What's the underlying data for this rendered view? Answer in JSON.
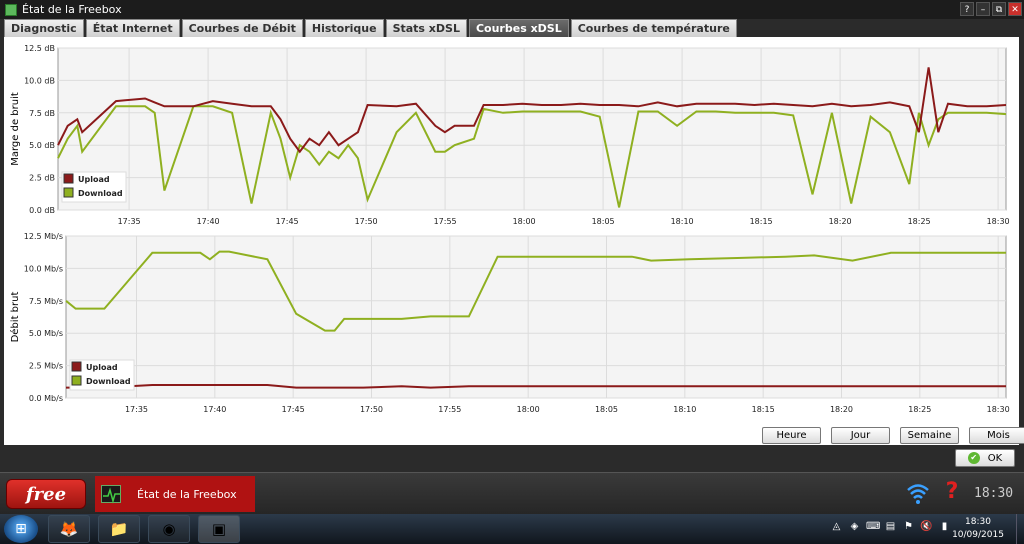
{
  "window": {
    "title": "État de la Freebox",
    "buttons": [
      "?",
      "–",
      "⧉",
      "✕"
    ]
  },
  "tabs": [
    {
      "label": "Diagnostic",
      "active": false
    },
    {
      "label": "État Internet",
      "active": false
    },
    {
      "label": "Courbes de Débit",
      "active": false
    },
    {
      "label": "Historique",
      "active": false
    },
    {
      "label": "Stats xDSL",
      "active": false
    },
    {
      "label": "Courbes xDSL",
      "active": true
    },
    {
      "label": "Courbes de température",
      "active": false
    }
  ],
  "range_buttons": [
    "Heure",
    "Jour",
    "Semaine",
    "Mois"
  ],
  "ok_label": "OK",
  "freebox_bar": {
    "logo": "free",
    "task_label": "État de la Freebox",
    "clock": "18:30"
  },
  "taskbar": {
    "time": "18:30",
    "date": "10/09/2015"
  },
  "colors": {
    "upload": "#8b1a1a",
    "download": "#8fb020"
  },
  "chart_data": [
    {
      "type": "line",
      "ylabel": "Marge de bruit",
      "ylim": [
        0,
        12.5
      ],
      "yticks": [
        "0.0 dB",
        "2.5 dB",
        "5.0 dB",
        "7.5 dB",
        "10.0 dB",
        "12.5 dB"
      ],
      "xticks": [
        "17:35",
        "17:40",
        "17:45",
        "17:50",
        "17:55",
        "18:00",
        "18:05",
        "18:10",
        "18:15",
        "18:20",
        "18:25",
        "18:30"
      ],
      "grid": true,
      "legend": "bottom-left",
      "series": [
        {
          "name": "Upload",
          "values": [
            [
              0,
              5.0
            ],
            [
              1,
              6.5
            ],
            [
              2,
              7.0
            ],
            [
              2.5,
              6.0
            ],
            [
              6,
              8.4
            ],
            [
              9,
              8.6
            ],
            [
              10,
              8.3
            ],
            [
              11,
              8.0
            ],
            [
              14,
              8.0
            ],
            [
              16,
              8.4
            ],
            [
              18,
              8.2
            ],
            [
              20,
              8.0
            ],
            [
              22,
              8.0
            ],
            [
              23,
              7.0
            ],
            [
              24,
              5.5
            ],
            [
              25,
              4.5
            ],
            [
              26,
              5.5
            ],
            [
              27,
              5.0
            ],
            [
              28,
              6.0
            ],
            [
              29,
              5.0
            ],
            [
              30,
              5.5
            ],
            [
              31,
              6.0
            ],
            [
              32,
              8.1
            ],
            [
              35,
              8.0
            ],
            [
              37,
              8.2
            ],
            [
              39,
              6.5
            ],
            [
              40,
              6.0
            ],
            [
              41,
              6.5
            ],
            [
              43,
              6.5
            ],
            [
              44,
              8.1
            ],
            [
              46,
              8.1
            ],
            [
              48,
              8.2
            ],
            [
              50,
              8.1
            ],
            [
              52,
              8.1
            ],
            [
              54,
              8.2
            ],
            [
              56,
              8.1
            ],
            [
              58,
              8.1
            ],
            [
              60,
              8.0
            ],
            [
              62,
              8.3
            ],
            [
              64,
              8.0
            ],
            [
              66,
              8.2
            ],
            [
              68,
              8.2
            ],
            [
              70,
              8.2
            ],
            [
              72,
              8.1
            ],
            [
              74,
              8.2
            ],
            [
              76,
              8.1
            ],
            [
              78,
              8.0
            ],
            [
              80,
              8.2
            ],
            [
              82,
              8.0
            ],
            [
              84,
              8.1
            ],
            [
              86,
              8.3
            ],
            [
              88,
              8.0
            ],
            [
              89,
              6.0
            ],
            [
              90,
              11.0
            ],
            [
              91,
              6.0
            ],
            [
              92,
              8.2
            ],
            [
              94,
              8.0
            ],
            [
              96,
              8.0
            ],
            [
              98,
              8.1
            ]
          ]
        },
        {
          "name": "Download",
          "values": [
            [
              0,
              4.0
            ],
            [
              1,
              5.5
            ],
            [
              2,
              6.5
            ],
            [
              2.5,
              4.5
            ],
            [
              6,
              8.0
            ],
            [
              9,
              8.0
            ],
            [
              10,
              7.5
            ],
            [
              11,
              1.5
            ],
            [
              14,
              8.0
            ],
            [
              16,
              8.0
            ],
            [
              18,
              7.5
            ],
            [
              20,
              0.5
            ],
            [
              22,
              7.5
            ],
            [
              23,
              5.5
            ],
            [
              24,
              2.5
            ],
            [
              25,
              5.0
            ],
            [
              26,
              4.5
            ],
            [
              27,
              3.5
            ],
            [
              28,
              4.5
            ],
            [
              29,
              4.0
            ],
            [
              30,
              5.0
            ],
            [
              31,
              4.0
            ],
            [
              32,
              0.8
            ],
            [
              35,
              6.0
            ],
            [
              37,
              7.5
            ],
            [
              39,
              4.5
            ],
            [
              40,
              4.5
            ],
            [
              41,
              5.0
            ],
            [
              43,
              5.5
            ],
            [
              44,
              7.8
            ],
            [
              46,
              7.5
            ],
            [
              48,
              7.6
            ],
            [
              50,
              7.6
            ],
            [
              52,
              7.6
            ],
            [
              54,
              7.6
            ],
            [
              56,
              7.2
            ],
            [
              58,
              0.2
            ],
            [
              60,
              7.6
            ],
            [
              62,
              7.6
            ],
            [
              64,
              6.5
            ],
            [
              66,
              7.6
            ],
            [
              68,
              7.6
            ],
            [
              70,
              7.5
            ],
            [
              72,
              7.5
            ],
            [
              74,
              7.5
            ],
            [
              76,
              7.3
            ],
            [
              78,
              1.2
            ],
            [
              80,
              7.5
            ],
            [
              82,
              0.5
            ],
            [
              84,
              7.2
            ],
            [
              86,
              6.0
            ],
            [
              88,
              2.0
            ],
            [
              89,
              7.5
            ],
            [
              90,
              5.0
            ],
            [
              91,
              7.0
            ],
            [
              92,
              7.5
            ],
            [
              94,
              7.5
            ],
            [
              96,
              7.5
            ],
            [
              98,
              7.4
            ]
          ]
        }
      ]
    },
    {
      "type": "line",
      "ylabel": "Débit brut",
      "ylim": [
        0,
        12.5
      ],
      "yticks": [
        "0.0 Mb/s",
        "2.5 Mb/s",
        "5.0 Mb/s",
        "7.5 Mb/s",
        "10.0 Mb/s",
        "12.5 Mb/s"
      ],
      "xticks": [
        "17:35",
        "17:40",
        "17:45",
        "17:50",
        "17:55",
        "18:00",
        "18:05",
        "18:10",
        "18:15",
        "18:20",
        "18:25",
        "18:30"
      ],
      "grid": true,
      "legend": "bottom-left",
      "series": [
        {
          "name": "Upload",
          "values": [
            [
              0,
              0.8
            ],
            [
              4,
              0.8
            ],
            [
              9,
              1.0
            ],
            [
              14,
              1.0
            ],
            [
              17,
              1.0
            ],
            [
              21,
              1.0
            ],
            [
              24,
              0.8
            ],
            [
              27,
              0.8
            ],
            [
              31,
              0.8
            ],
            [
              35,
              0.9
            ],
            [
              38,
              0.8
            ],
            [
              42,
              0.9
            ],
            [
              45,
              0.9
            ],
            [
              50,
              0.9
            ],
            [
              55,
              0.9
            ],
            [
              60,
              0.9
            ],
            [
              65,
              0.9
            ],
            [
              70,
              0.9
            ],
            [
              75,
              0.9
            ],
            [
              78,
              0.9
            ],
            [
              82,
              0.9
            ],
            [
              86,
              0.9
            ],
            [
              89,
              0.9
            ],
            [
              93,
              0.9
            ],
            [
              98,
              0.9
            ]
          ]
        },
        {
          "name": "Download",
          "values": [
            [
              0,
              7.5
            ],
            [
              1,
              6.9
            ],
            [
              4,
              6.9
            ],
            [
              9,
              11.2
            ],
            [
              14,
              11.2
            ],
            [
              15,
              10.7
            ],
            [
              16,
              11.3
            ],
            [
              17,
              11.3
            ],
            [
              21,
              10.7
            ],
            [
              24,
              6.5
            ],
            [
              27,
              5.2
            ],
            [
              28,
              5.2
            ],
            [
              29,
              6.1
            ],
            [
              31,
              6.1
            ],
            [
              35,
              6.1
            ],
            [
              38,
              6.3
            ],
            [
              42,
              6.3
            ],
            [
              45,
              10.9
            ],
            [
              48,
              10.9
            ],
            [
              50,
              10.9
            ],
            [
              55,
              10.9
            ],
            [
              59,
              10.9
            ],
            [
              61,
              10.6
            ],
            [
              65,
              10.7
            ],
            [
              70,
              10.8
            ],
            [
              75,
              10.9
            ],
            [
              78,
              11.0
            ],
            [
              82,
              10.6
            ],
            [
              86,
              11.2
            ],
            [
              89,
              11.2
            ],
            [
              93,
              11.2
            ],
            [
              98,
              11.2
            ]
          ]
        }
      ]
    }
  ]
}
